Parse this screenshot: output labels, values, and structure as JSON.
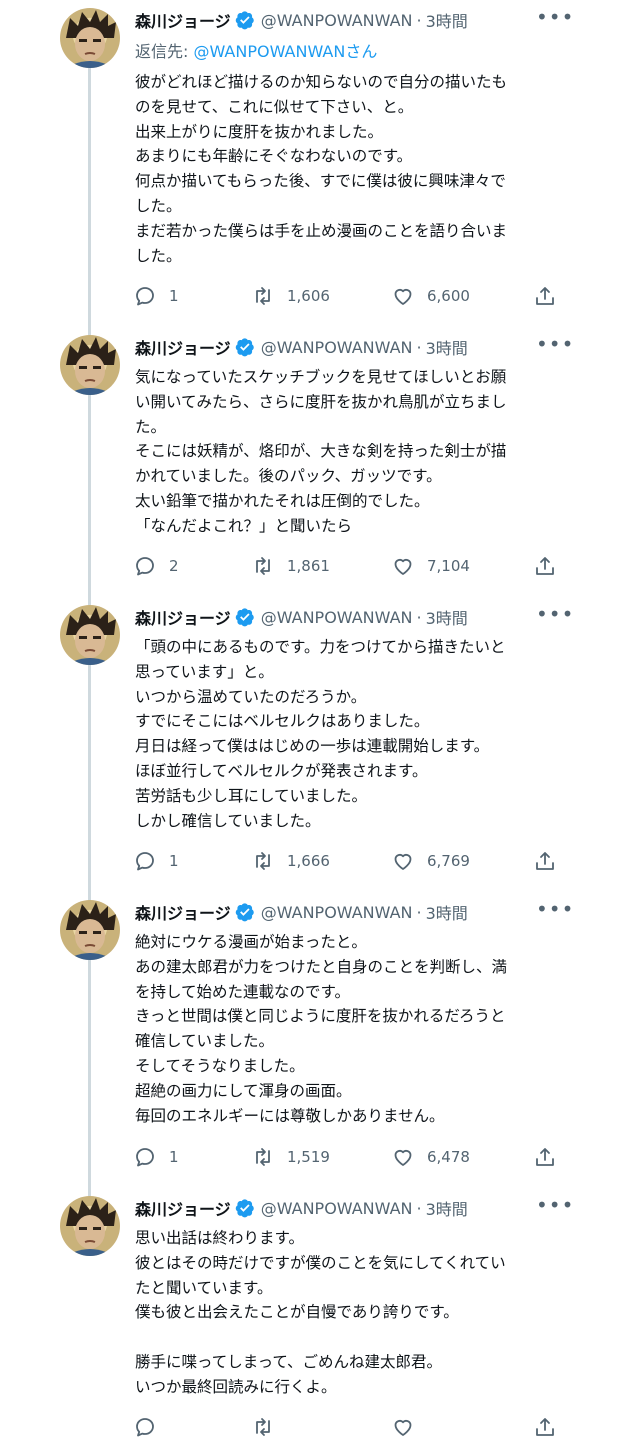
{
  "colors": {
    "accent": "#1d9bf0",
    "muted": "#536471",
    "text": "#0f1419",
    "thread_line": "#cfd9de"
  },
  "icons": {
    "verified": "verified-badge-icon",
    "more": "more-icon",
    "reply": "reply-icon",
    "retweet": "retweet-icon",
    "like": "heart-icon",
    "share": "share-icon"
  },
  "tweets": [
    {
      "name": "森川ジョージ",
      "handle": "@WANPOWANWAN",
      "separator": "·",
      "time": "3時間",
      "reply_prefix": "返信先: ",
      "reply_handle": "@WANPOWANWAN",
      "reply_suffix": "さん",
      "text": "彼がどれほど描けるのか知らないので自分の描いたも\nのを見せて、これに似せて下さい、と。\n出来上がりに度肝を抜かれました。\nあまりにも年齢にそぐなわないのです。\n何点か描いてもらった後、すでに僕は彼に興味津々で\nした。\nまだ若かった僕らは手を止め漫画のことを語り合いま\nした。",
      "replies": "1",
      "retweets": "1,606",
      "likes": "6,600"
    },
    {
      "name": "森川ジョージ",
      "handle": "@WANPOWANWAN",
      "separator": "·",
      "time": "3時間",
      "text": "気になっていたスケッチブックを見せてほしいとお願\nい開いてみたら、さらに度肝を抜かれ鳥肌が立ちまし\nた。\nそこには妖精が、烙印が、大きな剣を持った剣士が描\nかれていました。後のパック、ガッツです。\n太い鉛筆で描かれたそれは圧倒的でした。\n「なんだよこれ？」と聞いたら",
      "replies": "2",
      "retweets": "1,861",
      "likes": "7,104"
    },
    {
      "name": "森川ジョージ",
      "handle": "@WANPOWANWAN",
      "separator": "·",
      "time": "3時間",
      "text": "「頭の中にあるものです。力をつけてから描きたいと\n思っています」と。\nいつから温めていたのだろうか。\nすでにそこにはベルセルクはありました。\n月日は経って僕ははじめの一歩は連載開始します。\nほぼ並行してベルセルクが発表されます。\n苦労話も少し耳にしていました。\nしかし確信していました。",
      "replies": "1",
      "retweets": "1,666",
      "likes": "6,769"
    },
    {
      "name": "森川ジョージ",
      "handle": "@WANPOWANWAN",
      "separator": "·",
      "time": "3時間",
      "text": "絶対にウケる漫画が始まったと。\nあの建太郎君が力をつけたと自身のことを判断し、満\nを持して始めた連載なのです。\nきっと世間は僕と同じように度肝を抜かれるだろうと\n確信していました。\nそしてそうなりました。\n超絶の画力にして渾身の画面。\n毎回のエネルギーには尊敬しかありません。",
      "replies": "1",
      "retweets": "1,519",
      "likes": "6,478"
    },
    {
      "name": "森川ジョージ",
      "handle": "@WANPOWANWAN",
      "separator": "·",
      "time": "3時間",
      "text": "思い出話は終わります。\n彼とはその時だけですが僕のことを気にしてくれてい\nたと聞いています。\n僕も彼と出会えたことが自慢であり誇りです。\n\n勝手に喋ってしまって、ごめんね建太郎君。\nいつか最終回読みに行くよ。",
      "replies": "",
      "retweets": "",
      "likes": ""
    }
  ]
}
